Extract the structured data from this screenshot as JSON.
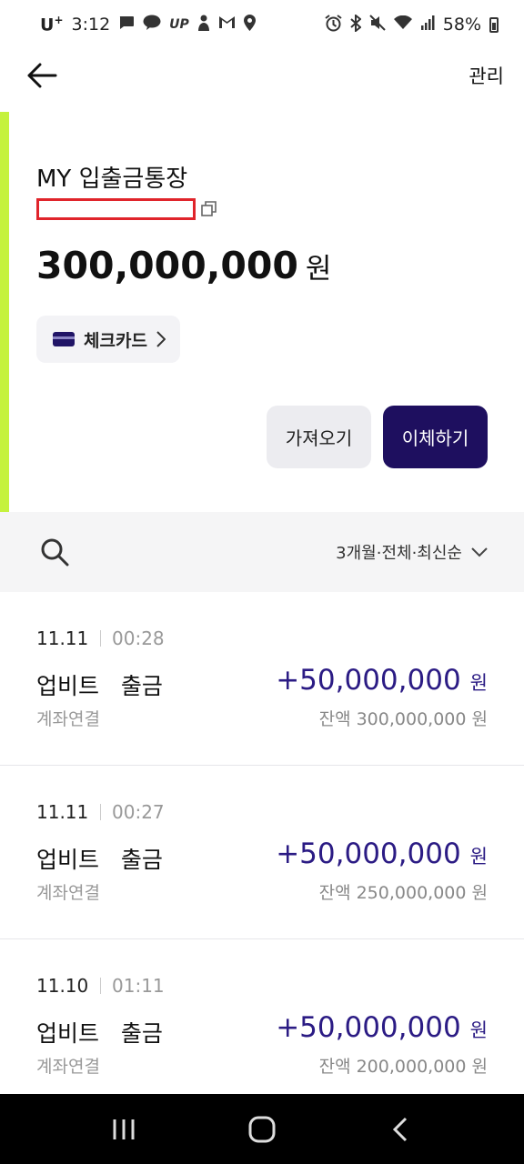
{
  "status_bar": {
    "carrier": "U",
    "carrier_sup": "+",
    "time": "3:12",
    "battery": "58%"
  },
  "header": {
    "manage_label": "관리"
  },
  "account": {
    "name": "MY 입출금통장",
    "balance_amount": "300,000,000",
    "balance_unit": "원",
    "card_label": "체크카드",
    "fetch_label": "가져오기",
    "transfer_label": "이체하기",
    "accent_color": "#c5f23d",
    "primary_color": "#1e0f5f",
    "redaction_color": "#e0242b"
  },
  "filter": {
    "label": "3개월·전체·최신순"
  },
  "transactions": [
    {
      "date": "11.11",
      "time": "00:28",
      "title": "업비트   출금",
      "subtitle": "계좌연결",
      "amount": "+50,000,000",
      "unit": "원",
      "balance": "잔액 300,000,000 원"
    },
    {
      "date": "11.11",
      "time": "00:27",
      "title": "업비트   출금",
      "subtitle": "계좌연결",
      "amount": "+50,000,000",
      "unit": "원",
      "balance": "잔액 250,000,000 원"
    },
    {
      "date": "11.10",
      "time": "01:11",
      "title": "업비트   출금",
      "subtitle": "계좌연결",
      "amount": "+50,000,000",
      "unit": "원",
      "balance": "잔액 200,000,000 원"
    }
  ]
}
